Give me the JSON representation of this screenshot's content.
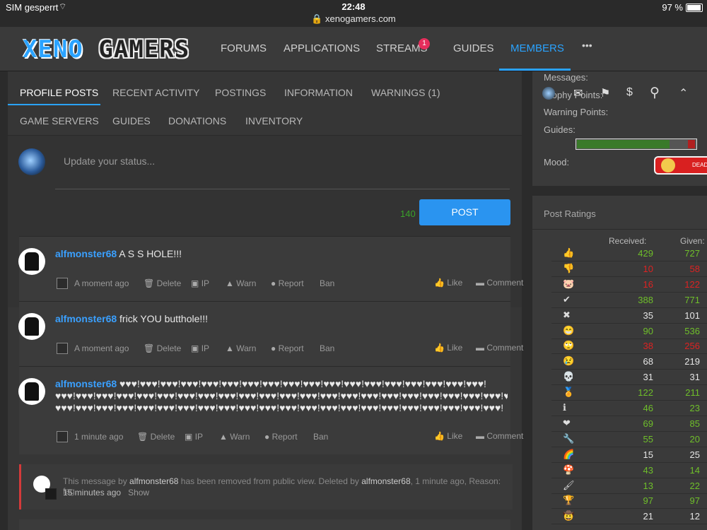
{
  "statusbar": {
    "carrier": "SIM gesperrt",
    "time": "22:48",
    "url": "xenogamers.com",
    "battery": "97 %"
  },
  "logo": {
    "part1": "XENO",
    "part2": "GAMERS"
  },
  "nav": {
    "forums": "FORUMS",
    "applications": "APPLICATIONS",
    "streams": "STREAMS",
    "streams_badge": "1",
    "guides": "GUIDES",
    "members": "MEMBERS",
    "more": "•••"
  },
  "tabs": {
    "profile_posts": "PROFILE POSTS",
    "recent_activity": "RECENT ACTIVITY",
    "postings": "POSTINGS",
    "information": "INFORMATION",
    "warnings": "WARNINGS (1)",
    "game_servers": "GAME SERVERS",
    "guides": "GUIDES",
    "donations": "DONATIONS",
    "inventory": "INVENTORY"
  },
  "status": {
    "placeholder": "Update your status...",
    "charcount": "140",
    "post_button": "POST"
  },
  "actions": {
    "delete": "Delete",
    "ip": "IP",
    "warn": "Warn",
    "report": "Report",
    "ban": "Ban",
    "like": "Like",
    "comment": "Comment"
  },
  "posts": [
    {
      "user": "alfmonster68",
      "text": "A S S HOLE!!!",
      "time": "A moment ago"
    },
    {
      "user": "alfmonster68",
      "text": "frick YOU butthole!!!",
      "time": "A moment ago"
    },
    {
      "user": "alfmonster68",
      "text1": "♥♥♥!♥♥♥!♥♥♥!♥♥♥!♥♥♥!♥♥♥!♥♥♥!♥♥♥!♥♥♥!♥♥♥!♥♥♥!♥♥♥!♥♥♥!♥♥♥!♥♥♥!♥♥♥!♥♥♥!♥♥♥!",
      "text2": "♥♥♥!♥♥♥!♥♥♥!♥♥♥!♥♥♥!♥♥♥!♥♥♥!♥♥♥!♥♥♥!♥♥♥!♥♥♥!♥♥♥!♥♥♥!♥♥♥!♥♥♥!♥♥♥!♥♥♥!♥♥♥!♥♥♥!♥♥♥!♥♥♥!♥♥♥!♥♥♥!♥♥♥!",
      "text3": "♥♥♥!♥♥♥!♥♥♥!♥♥♥!♥♥♥!♥♥♥!♥♥♥!♥♥♥!♥♥♥!♥♥♥!♥♥♥!♥♥♥!♥♥♥!♥♥♥!♥♥♥!♥♥♥!♥♥♥!♥♥♥!♥♥♥!♥♥♥!♥♥♥!♥♥♥!",
      "time": "1 minute ago"
    }
  ],
  "removed": {
    "prefix": "This message by",
    "user": "alfmonster68",
    "middle": "has been removed from public view. Deleted by",
    "deleter": "alfmonster68",
    "suffix": ", 1 minute ago, Reason: fag.",
    "time": "15 minutes ago",
    "show": "Show"
  },
  "sidebar": {
    "messages": "Messages:",
    "trophy": "Trophy Points:",
    "warning": "Warning Points:",
    "guides": "Guides:",
    "mood": "Mood:",
    "mood_text": "DEAD",
    "guides_progress": 0.78
  },
  "ratings": {
    "title": "Post Ratings",
    "received": "Received:",
    "given": "Given:",
    "rows": [
      {
        "icon": "👍",
        "r": "429",
        "g": "727",
        "rc": "green",
        "gc": "green"
      },
      {
        "icon": "👎",
        "r": "10",
        "g": "58",
        "rc": "red",
        "gc": "red"
      },
      {
        "icon": "🐷",
        "r": "16",
        "g": "122",
        "rc": "red",
        "gc": "red"
      },
      {
        "icon": "✔",
        "r": "388",
        "g": "771",
        "rc": "green",
        "gc": "green"
      },
      {
        "icon": "✖",
        "r": "35",
        "g": "101",
        "rc": "white",
        "gc": "white"
      },
      {
        "icon": "😁",
        "r": "90",
        "g": "536",
        "rc": "green",
        "gc": "green"
      },
      {
        "icon": "🙄",
        "r": "38",
        "g": "256",
        "rc": "red",
        "gc": "red"
      },
      {
        "icon": "😢",
        "r": "68",
        "g": "219",
        "rc": "white",
        "gc": "white"
      },
      {
        "icon": "💀",
        "r": "31",
        "g": "31",
        "rc": "white",
        "gc": "white"
      },
      {
        "icon": "🏅",
        "r": "122",
        "g": "211",
        "rc": "green",
        "gc": "green"
      },
      {
        "icon": "ℹ",
        "r": "46",
        "g": "23",
        "rc": "green",
        "gc": "green"
      },
      {
        "icon": "❤",
        "r": "69",
        "g": "85",
        "rc": "green",
        "gc": "green"
      },
      {
        "icon": "🔧",
        "r": "55",
        "g": "20",
        "rc": "green",
        "gc": "green"
      },
      {
        "icon": "🌈",
        "r": "15",
        "g": "25",
        "rc": "white",
        "gc": "white"
      },
      {
        "icon": "🍄",
        "r": "43",
        "g": "14",
        "rc": "green",
        "gc": "green"
      },
      {
        "icon": "🖌",
        "r": "13",
        "g": "22",
        "rc": "green",
        "gc": "green"
      },
      {
        "icon": "🏆",
        "r": "97",
        "g": "97",
        "rc": "green",
        "gc": "green"
      },
      {
        "icon": "🤠",
        "r": "21",
        "g": "12",
        "rc": "white",
        "gc": "white"
      }
    ]
  }
}
